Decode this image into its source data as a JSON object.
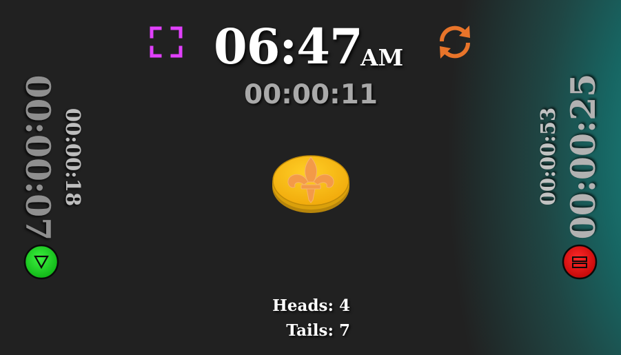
{
  "clock": {
    "time": "06:47",
    "period": "AM"
  },
  "elapsed": "00:00:11",
  "left_player": {
    "main_time": "00:00:07",
    "sub_time": "00:00:18"
  },
  "right_player": {
    "main_time": "00:00:25",
    "sub_time": "00:00:53"
  },
  "tally": {
    "heads_label": "Heads:",
    "heads_count": "4",
    "tails_label": "Tails:",
    "tails_count": "7"
  },
  "icons": {
    "fullscreen": "fullscreen-icon",
    "refresh": "refresh-icon",
    "left_button": "triangle-down-icon",
    "right_button": "pause-bars-icon",
    "coin": "fleur-de-lis-coin"
  },
  "colors": {
    "background": "#212121",
    "teal_glow": "#1a7a76",
    "fullscreen_accent": "#e040fb",
    "refresh_accent": "#e8742a",
    "left_button": "#16d21c",
    "right_button": "#dc0e0e",
    "coin_gold": "#f5b60f",
    "coin_emblem": "#f39a48"
  }
}
